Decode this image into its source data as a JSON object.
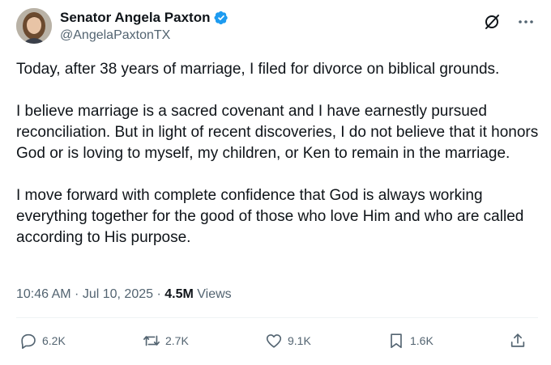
{
  "author": {
    "display_name": "Senator Angela Paxton",
    "handle": "@AngelaPaxtonTX",
    "verified": true
  },
  "tweet": {
    "paragraphs": [
      "Today, after 38 years of marriage, I filed for divorce on biblical grounds.",
      "I believe marriage is a sacred covenant and I have earnestly pursued reconciliation. But in light of recent discoveries, I do not believe that it honors God or is loving to myself, my children, or Ken to remain in the marriage.",
      "I move forward with complete confidence that God is always working everything together for the good of those who love Him and who are called according to His purpose."
    ]
  },
  "meta": {
    "time": "10:46 AM",
    "separator1": " · ",
    "date": "Jul 10, 2025",
    "separator2": " · ",
    "views_count": "4.5M",
    "views_label": " Views"
  },
  "actions": {
    "replies": "6.2K",
    "reposts": "2.7K",
    "likes": "9.1K",
    "bookmarks": "1.6K"
  },
  "colors": {
    "text": "#0f1419",
    "secondary": "#536471",
    "verified": "#1d9bf0",
    "divider": "#eff3f4"
  },
  "icons": [
    "verified-badge-icon",
    "grok-icon",
    "more-icon",
    "reply-icon",
    "repost-icon",
    "like-icon",
    "bookmark-icon",
    "share-icon"
  ]
}
